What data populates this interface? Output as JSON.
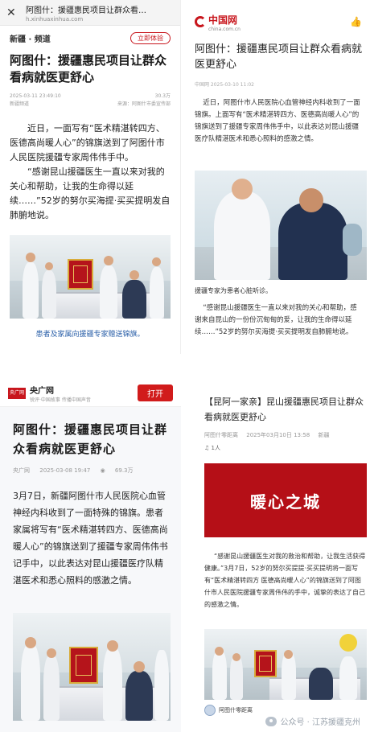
{
  "panel1": {
    "page_title": "阿图什：援疆惠民项目让群众看病...",
    "url": "h.xinhuaxinhua.com",
    "close_icon": "close-icon",
    "channel": "新疆 · 频道",
    "open_button": "立即体验",
    "headline": "阿图什：援疆惠民项目让群众看病就医更舒心",
    "date": "2025-03-11 23:49:10",
    "views": "30.3万",
    "editor": "新疆频道",
    "source": "来源：阿图什市委宣传部",
    "body1": "近日，一面写有“医术精湛转四方、医德高尚暖人心”的锦旗送到了阿图什市人民医院援疆专家周伟伟手中。",
    "body2": "“感谢昆山援疆医生一直以来对我的关心和帮助，让我的生命得以延续……”52岁的努尔买海提·买买提明发自肺腑地说。",
    "caption": "患者及家属向援疆专家赠送锦旗。"
  },
  "panel2": {
    "logo": "中国网",
    "logo_sub": "china.com.cn",
    "thumb_icon": "thumbs-up-icon",
    "headline": "阿图什：援疆惠民项目让群众看病就医更舒心",
    "meta": "中国网  2025-03-10 11:02",
    "body1": "近日，阿图什市人民医院心血管神经内科收到了一面锦旗。上面写有“医术精湛转四方、医德高尚暖人心”的锦旗送到了援疆专家周伟伟手中，以此表达对昆山援疆医疗队精湛医术和悉心照料的感激之情。",
    "caption": "援疆专家为患者心脏听诊。",
    "body2": "“感谢昆山援疆医生一直以来对我的关心和帮助，感谢来自昆山的一份份沉甸甸的爱，让我的生命得以延续……”52岁的努尔买海提·买买提明发自肺腑地说。"
  },
  "panel3": {
    "logo": "央广网",
    "brand": "央广网",
    "tagline": "锐评·中国故事 传播中国声音",
    "open_button": "打开",
    "headline": "阿图什：援疆惠民项目让群众看病就医更舒心",
    "source": "央广网",
    "date": "2025-03-08 19:47",
    "views": "69.3万",
    "body": "3月7日，新疆阿图什市人民医院心血管神经内科收到了一面特殊的锦旗。患者家属将写有“医术精湛转四方、医德高尚暖人心”的锦旗送到了援疆专家周伟伟书记手中，以此表达对昆山援疆医疗队精湛医术和悉心照料的感激之情。"
  },
  "panel4": {
    "headline": "【昆阿一家亲】昆山援疆惠民项目让群众看病就医更舒心",
    "account": "阿图什零距离",
    "date": "2025年03月10日 13:58",
    "region": "新疆",
    "listen": "1人",
    "banner_text": "暖心之城",
    "body": "“感谢昆山援疆医生对我的救治和帮助，让我生活获得健康。”3月7日，52岁的努尔买提提·买买提明将一面写有“医术精湛转四方 医德高尚暖人心”的锦旗送到了阿图什市人民医院援疆专家周伟伟的手中，诚挚的表达了自己的感激之情。",
    "footer_account": "阿图什零距离",
    "watermark": "公众号 · 江苏援疆克州"
  }
}
